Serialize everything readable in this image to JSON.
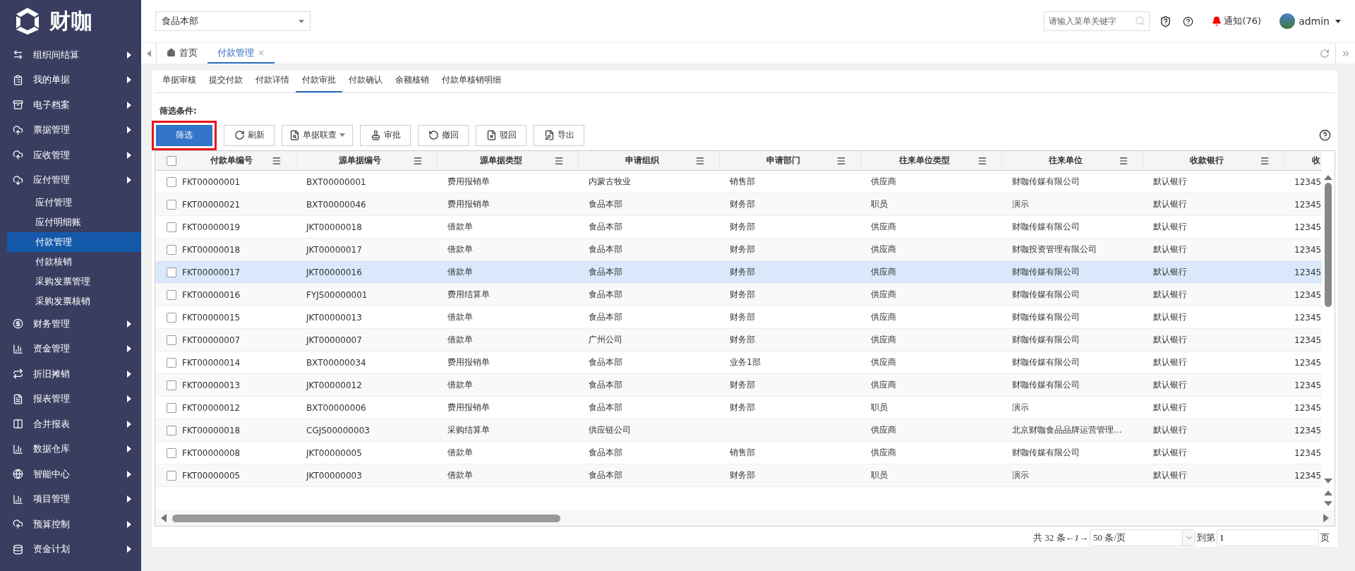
{
  "brand": {
    "name": "财咖"
  },
  "sidebar": {
    "items": [
      {
        "label": "组织间结算",
        "selected": false
      },
      {
        "label": "我的单据",
        "selected": false
      },
      {
        "label": "电子档案",
        "selected": false
      },
      {
        "label": "票据管理",
        "selected": false
      },
      {
        "label": "应收管理",
        "selected": false
      },
      {
        "label": "应付管理",
        "selected": false,
        "children": [
          {
            "label": "应付管理",
            "selected": false
          },
          {
            "label": "应付明细账",
            "selected": false
          },
          {
            "label": "付款管理",
            "selected": true
          },
          {
            "label": "付款核销",
            "selected": false
          },
          {
            "label": "采购发票管理",
            "selected": false
          },
          {
            "label": "采购发票核销",
            "selected": false
          }
        ]
      },
      {
        "label": "财务管理",
        "selected": false
      },
      {
        "label": "资金管理",
        "selected": false
      },
      {
        "label": "折旧摊销",
        "selected": false
      },
      {
        "label": "报表管理",
        "selected": false
      },
      {
        "label": "合并报表",
        "selected": false
      },
      {
        "label": "数据仓库",
        "selected": false
      },
      {
        "label": "智能中心",
        "selected": false
      },
      {
        "label": "项目管理",
        "selected": false
      },
      {
        "label": "预算控制",
        "selected": false
      },
      {
        "label": "资金计划",
        "selected": false
      }
    ]
  },
  "header": {
    "org_select": {
      "value": "食品本部"
    },
    "search": {
      "placeholder": "请输入菜单关键字"
    },
    "notifications": {
      "label": "通知(76)"
    },
    "user": {
      "name": "admin"
    }
  },
  "page_tabs": [
    {
      "label": "首页",
      "selected": false
    },
    {
      "label": "付款管理",
      "selected": true,
      "close": "×"
    }
  ],
  "sub_tabs": [
    {
      "label": "单据审核",
      "selected": false
    },
    {
      "label": "提交付款",
      "selected": false
    },
    {
      "label": "付款详情",
      "selected": false
    },
    {
      "label": "付款审批",
      "selected": true
    },
    {
      "label": "付款确认",
      "selected": false
    },
    {
      "label": "余额核销",
      "selected": false
    },
    {
      "label": "付款单核销明细",
      "selected": false
    }
  ],
  "filter_label": "筛选条件:",
  "toolbar": [
    {
      "label": "筛选",
      "kind": "primary",
      "highlighted": true
    },
    {
      "label": "刷新",
      "kind": "normal",
      "highlighted": false
    },
    {
      "label": "单据联查",
      "kind": "dropdown",
      "highlighted": false
    },
    {
      "label": "审批",
      "kind": "normal",
      "highlighted": false
    },
    {
      "label": "撤回",
      "kind": "normal",
      "highlighted": false
    },
    {
      "label": "驳回",
      "kind": "normal",
      "highlighted": false
    },
    {
      "label": "导出",
      "kind": "normal",
      "highlighted": false
    }
  ],
  "table": {
    "header_checked": false,
    "columns": [
      "付款单编号",
      "源单据编号",
      "源单据类型",
      "申请组织",
      "申请部门",
      "往来单位类型",
      "往来单位",
      "收款银行",
      "收"
    ],
    "rows": [
      {
        "checked": false,
        "highlighted": false,
        "cells": [
          "FKT00000001",
          "BXT00000001",
          "费用报销单",
          "内蒙古牧业",
          "销售部",
          "供应商",
          "财咖传媒有限公司",
          "默认银行",
          "12345"
        ]
      },
      {
        "checked": false,
        "highlighted": false,
        "cells": [
          "FKT00000021",
          "BXT00000046",
          "费用报销单",
          "食品本部",
          "财务部",
          "职员",
          "演示",
          "默认银行",
          "12345"
        ]
      },
      {
        "checked": false,
        "highlighted": false,
        "cells": [
          "FKT00000019",
          "JKT00000018",
          "借款单",
          "食品本部",
          "财务部",
          "供应商",
          "财咖传媒有限公司",
          "默认银行",
          "12345"
        ]
      },
      {
        "checked": false,
        "highlighted": false,
        "cells": [
          "FKT00000018",
          "JKT00000017",
          "借款单",
          "食品本部",
          "财务部",
          "供应商",
          "财咖投资管理有限公司",
          "默认银行",
          "12345"
        ]
      },
      {
        "checked": false,
        "highlighted": true,
        "cells": [
          "FKT00000017",
          "JKT00000016",
          "借款单",
          "食品本部",
          "财务部",
          "供应商",
          "财咖传媒有限公司",
          "默认银行",
          "12345"
        ]
      },
      {
        "checked": false,
        "highlighted": false,
        "cells": [
          "FKT00000016",
          "FYJS00000001",
          "费用结算单",
          "食品本部",
          "财务部",
          "供应商",
          "财咖传媒有限公司",
          "默认银行",
          "12345"
        ]
      },
      {
        "checked": false,
        "highlighted": false,
        "cells": [
          "FKT00000015",
          "JKT00000013",
          "借款单",
          "食品本部",
          "财务部",
          "供应商",
          "财咖传媒有限公司",
          "默认银行",
          "12345"
        ]
      },
      {
        "checked": false,
        "highlighted": false,
        "cells": [
          "FKT00000007",
          "JKT00000007",
          "借款单",
          "广州公司",
          "财务部",
          "供应商",
          "财咖传媒有限公司",
          "默认银行",
          "12345"
        ]
      },
      {
        "checked": false,
        "highlighted": false,
        "cells": [
          "FKT00000014",
          "BXT00000034",
          "费用报销单",
          "食品本部",
          "业务1部",
          "供应商",
          "财咖传媒有限公司",
          "默认银行",
          "12345"
        ]
      },
      {
        "checked": false,
        "highlighted": false,
        "cells": [
          "FKT00000013",
          "JKT00000012",
          "借款单",
          "食品本部",
          "财务部",
          "供应商",
          "财咖传媒有限公司",
          "默认银行",
          "12345"
        ]
      },
      {
        "checked": false,
        "highlighted": false,
        "cells": [
          "FKT00000012",
          "BXT00000006",
          "费用报销单",
          "食品本部",
          "财务部",
          "职员",
          "演示",
          "默认银行",
          "12345"
        ]
      },
      {
        "checked": false,
        "highlighted": false,
        "cells": [
          "FKT00000018",
          "CGJS00000003",
          "采购结算单",
          "供应链公司",
          "",
          "供应商",
          "北京财咖食品品牌运营管理...",
          "默认银行",
          "12345"
        ]
      },
      {
        "checked": false,
        "highlighted": false,
        "cells": [
          "FKT00000008",
          "JKT00000005",
          "借款单",
          "食品本部",
          "销售部",
          "供应商",
          "财咖传媒有限公司",
          "默认银行",
          "12345"
        ]
      },
      {
        "checked": false,
        "highlighted": false,
        "cells": [
          "FKT00000005",
          "JKT00000003",
          "借款单",
          "食品本部",
          "财务部",
          "职员",
          "演示",
          "默认银行",
          "12345"
        ]
      }
    ]
  },
  "pagination": {
    "total": "共 32 条←*1*→",
    "page_size": "50 条/页",
    "goto_label": "到第",
    "goto_value": "1",
    "page_suffix": "页"
  }
}
